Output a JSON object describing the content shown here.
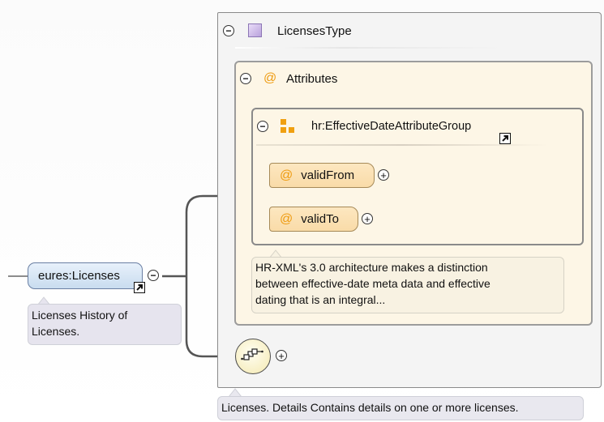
{
  "complex_type": {
    "name": "LicensesType"
  },
  "attributes_group": {
    "label": "Attributes",
    "at_symbol": "@"
  },
  "attribute_group": {
    "name": "hr:EffectiveDateAttributeGroup",
    "items": [
      {
        "at": "@",
        "name": "validFrom"
      },
      {
        "at": "@",
        "name": "validTo"
      }
    ],
    "note_lines": [
      "HR-XML's 3.0 architecture makes a distinction",
      "between effective-date meta data and effective",
      "dating that is an integral..."
    ]
  },
  "element": {
    "name": "eures:Licenses",
    "note_lines": [
      "Licenses History of",
      "Licenses."
    ]
  },
  "type_note": "Licenses. Details Contains details on one or more licenses.",
  "symbols": {
    "collapse": "⊖",
    "expand": "⊕",
    "minus": "−",
    "plus": "+"
  },
  "colors": {
    "attribute_accent": "#ee9b10",
    "element_fill": "#c9dcef",
    "type_icon": "#b9a2dc",
    "attribute_fill": "#fbe0b2"
  },
  "icons": {
    "type": "square-type-icon",
    "attribute_group": "attribute-group-icon",
    "link": "link-arrow-icon",
    "sequence": "sequence-compositor-icon"
  }
}
